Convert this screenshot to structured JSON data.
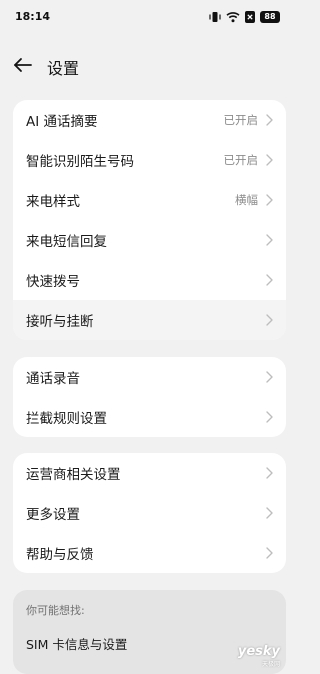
{
  "status_bar": {
    "time": "18:14",
    "battery": "88",
    "icons": [
      "vibrate-icon",
      "wifi-icon",
      "close-box-icon",
      "battery-icon"
    ]
  },
  "header": {
    "title": "设置",
    "back_icon": "arrow-left-icon"
  },
  "groups": [
    {
      "items": [
        {
          "label": "AI 通话摘要",
          "value": "已开启"
        },
        {
          "label": "智能识别陌生号码",
          "value": "已开启"
        },
        {
          "label": "来电样式",
          "value": "横幅"
        },
        {
          "label": "来电短信回复",
          "value": ""
        },
        {
          "label": "快速拨号",
          "value": ""
        },
        {
          "label": "接听与挂断",
          "value": "",
          "highlighted": true
        }
      ]
    },
    {
      "items": [
        {
          "label": "通话录音",
          "value": ""
        },
        {
          "label": "拦截规则设置",
          "value": ""
        }
      ]
    },
    {
      "items": [
        {
          "label": "运营商相关设置",
          "value": ""
        },
        {
          "label": "更多设置",
          "value": ""
        },
        {
          "label": "帮助与反馈",
          "value": ""
        }
      ]
    }
  ],
  "suggestions": {
    "title": "你可能想找:",
    "items": [
      "SIM 卡信息与设置"
    ]
  },
  "watermark": {
    "main": "yesky",
    "sub": "天极网"
  },
  "colors": {
    "background": "#f1f1f1",
    "card": "#ffffff",
    "suggest_card": "#e4e4e4",
    "secondary_text": "#8c8c8c",
    "chevron": "#bdbdbd"
  }
}
